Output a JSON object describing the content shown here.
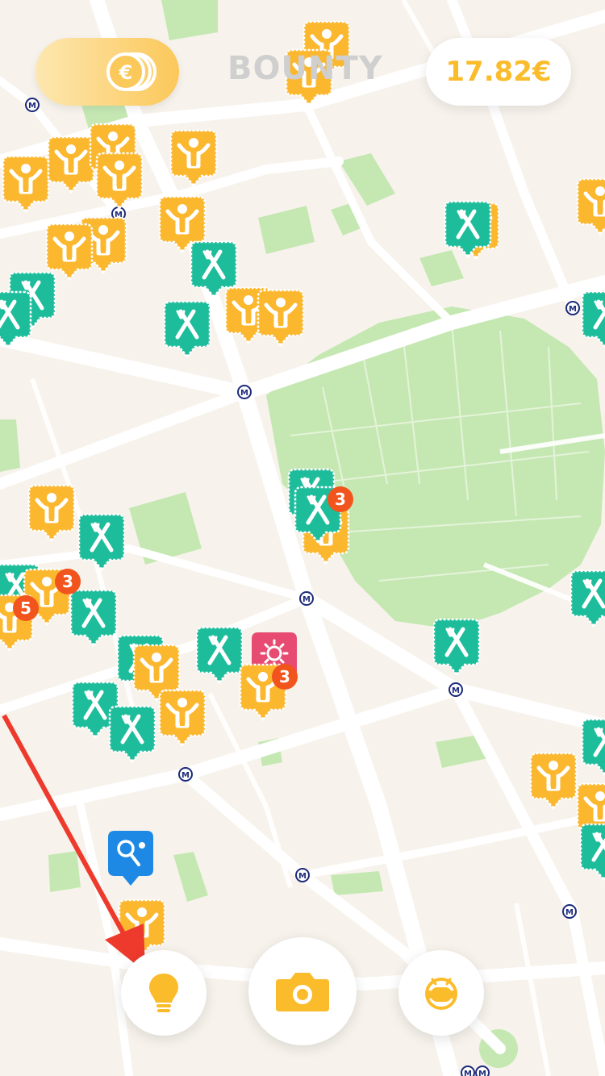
{
  "header": {
    "mode_title": "BOUNTY",
    "balance": "17.82€",
    "coin_symbol": "€"
  },
  "markers": {
    "types": {
      "bounty": {
        "icon": "bounty-figure-icon",
        "color": "#fbb72e"
      },
      "restaurant": {
        "icon": "fork-knife-icon",
        "color": "#1dbd9b"
      },
      "fitness": {
        "icon": "sun-icon",
        "color": "#e74b72"
      },
      "sports": {
        "icon": "badminton-icon",
        "color": "#1e88e5"
      }
    },
    "cluster_badges": [
      "3",
      "3",
      "5",
      "3"
    ],
    "badge_color": "#f2541d"
  },
  "metro_stations": {
    "symbol": "M",
    "color": "#1c2a7a"
  },
  "bottom_bar": {
    "tips_icon": "lightbulb-icon",
    "camera_icon": "camera-icon",
    "profile_icon": "astronaut-helmet-icon"
  },
  "colors": {
    "accent": "#fbbc2c",
    "map_background": "#f7f3ec",
    "park": "#c5e8b3",
    "annotation_arrow": "#ee3a2c"
  }
}
